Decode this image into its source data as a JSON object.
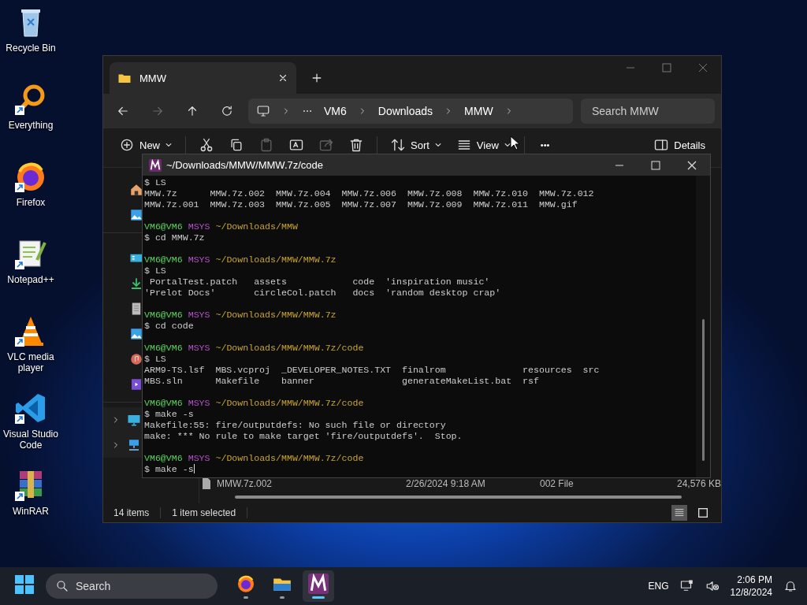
{
  "desktop_icons": [
    {
      "kind": "recycle",
      "label": "Recycle Bin"
    },
    {
      "kind": "everything",
      "label": "Everything"
    },
    {
      "kind": "firefox",
      "label": "Firefox"
    },
    {
      "kind": "notepad",
      "label": "Notepad++"
    },
    {
      "kind": "vlc",
      "label": "VLC media player"
    },
    {
      "kind": "vscode",
      "label": "Visual Studio Code"
    },
    {
      "kind": "winrar",
      "label": "WinRAR"
    }
  ],
  "explorer": {
    "tabs": [
      {
        "label": "MMW",
        "selected": true
      }
    ],
    "breadcrumb": [
      "VM6",
      "Downloads",
      "MMW"
    ],
    "search": {
      "placeholder": "Search MMW"
    },
    "toolbar": [
      {
        "kind": "new",
        "label": "New"
      },
      {
        "kind": "cut",
        "disabled": false
      },
      {
        "kind": "copy",
        "disabled": false
      },
      {
        "kind": "paste",
        "disabled": true
      },
      {
        "kind": "rename",
        "disabled": false
      },
      {
        "kind": "share",
        "disabled": true
      },
      {
        "kind": "delete",
        "disabled": false
      },
      {
        "kind": "sort",
        "label": "Sort"
      },
      {
        "kind": "view",
        "label": "View"
      },
      {
        "kind": "more",
        "label": "•••"
      },
      {
        "kind": "details",
        "label": "Details"
      }
    ],
    "quick_access": [
      {
        "kind": "home"
      },
      {
        "kind": "gallery"
      }
    ],
    "libraries": [
      {
        "kind": "desktop"
      },
      {
        "kind": "downloads"
      },
      {
        "kind": "documents"
      },
      {
        "kind": "pictures"
      },
      {
        "kind": "music"
      },
      {
        "kind": "videos"
      }
    ],
    "tree": [
      {
        "kind": "pc",
        "expanded": false
      },
      {
        "kind": "network",
        "expanded": false
      }
    ],
    "file_row": {
      "name": "MMW.7z.002",
      "date": "2/26/2024 9:18 AM",
      "type": "002 File",
      "size": "24,576 KB"
    },
    "status_bar": {
      "count": "14 items",
      "selection": "1 item selected"
    },
    "view_buttons": [
      {
        "kind": "details",
        "selected": true
      },
      {
        "kind": "tiles",
        "selected": false
      }
    ]
  },
  "terminal": {
    "title": "~/Downloads/MMW/MMW.7z/code",
    "lines": [
      {
        "kind": "text",
        "text": "$ LS"
      },
      {
        "kind": "text",
        "text": "MMW.7z      MMW.7z.002  MMW.7z.004  MMW.7z.006  MMW.7z.008  MMW.7z.010  MMW.7z.012"
      },
      {
        "kind": "text",
        "text": "MMW.7z.001  MMW.7z.003  MMW.7z.005  MMW.7z.007  MMW.7z.009  MMW.7z.011  MMW.gif"
      },
      {
        "kind": "blank"
      },
      {
        "kind": "prompt",
        "user": "VM6@VM6",
        "shell": "MSYS",
        "path": "~/Downloads/MMW"
      },
      {
        "kind": "text",
        "text": "$ cd MMW.7z"
      },
      {
        "kind": "blank"
      },
      {
        "kind": "prompt",
        "user": "VM6@VM6",
        "shell": "MSYS",
        "path": "~/Downloads/MMW/MMW.7z"
      },
      {
        "kind": "text",
        "text": "$ LS"
      },
      {
        "kind": "text",
        "text": " PortalTest.patch   assets            code  'inspiration music'"
      },
      {
        "kind": "text",
        "text": "'Prelot Docs'       circleCol.patch   docs  'random desktop crap'"
      },
      {
        "kind": "blank"
      },
      {
        "kind": "prompt",
        "user": "VM6@VM6",
        "shell": "MSYS",
        "path": "~/Downloads/MMW/MMW.7z"
      },
      {
        "kind": "text",
        "text": "$ cd code"
      },
      {
        "kind": "blank"
      },
      {
        "kind": "prompt",
        "user": "VM6@VM6",
        "shell": "MSYS",
        "path": "~/Downloads/MMW/MMW.7z/code"
      },
      {
        "kind": "text",
        "text": "$ LS"
      },
      {
        "kind": "text",
        "text": "ARM9-TS.lsf  MBS.vcproj  _DEVELOPER_NOTES.TXT  finalrom              resources  src"
      },
      {
        "kind": "text",
        "text": "MBS.sln      Makefile    banner                generateMakeList.bat  rsf"
      },
      {
        "kind": "blank"
      },
      {
        "kind": "prompt",
        "user": "VM6@VM6",
        "shell": "MSYS",
        "path": "~/Downloads/MMW/MMW.7z/code"
      },
      {
        "kind": "text",
        "text": "$ make -s"
      },
      {
        "kind": "text",
        "text": "Makefile:55: fire/outputdefs: No such file or directory"
      },
      {
        "kind": "text",
        "text": "make: *** No rule to make target 'fire/outputdefs'.  Stop."
      },
      {
        "kind": "blank"
      },
      {
        "kind": "prompt",
        "user": "VM6@VM6",
        "shell": "MSYS",
        "path": "~/Downloads/MMW/MMW.7z/code"
      },
      {
        "kind": "input",
        "text": "$ make -s"
      }
    ]
  },
  "taskbar": {
    "search": {
      "placeholder": "Search"
    },
    "apps": [
      {
        "kind": "firefox",
        "selected": false
      },
      {
        "kind": "explorer",
        "selected": false
      },
      {
        "kind": "msys",
        "selected": true
      }
    ],
    "language": "ENG",
    "time": "2:06 PM",
    "date": "12/8/2024"
  }
}
